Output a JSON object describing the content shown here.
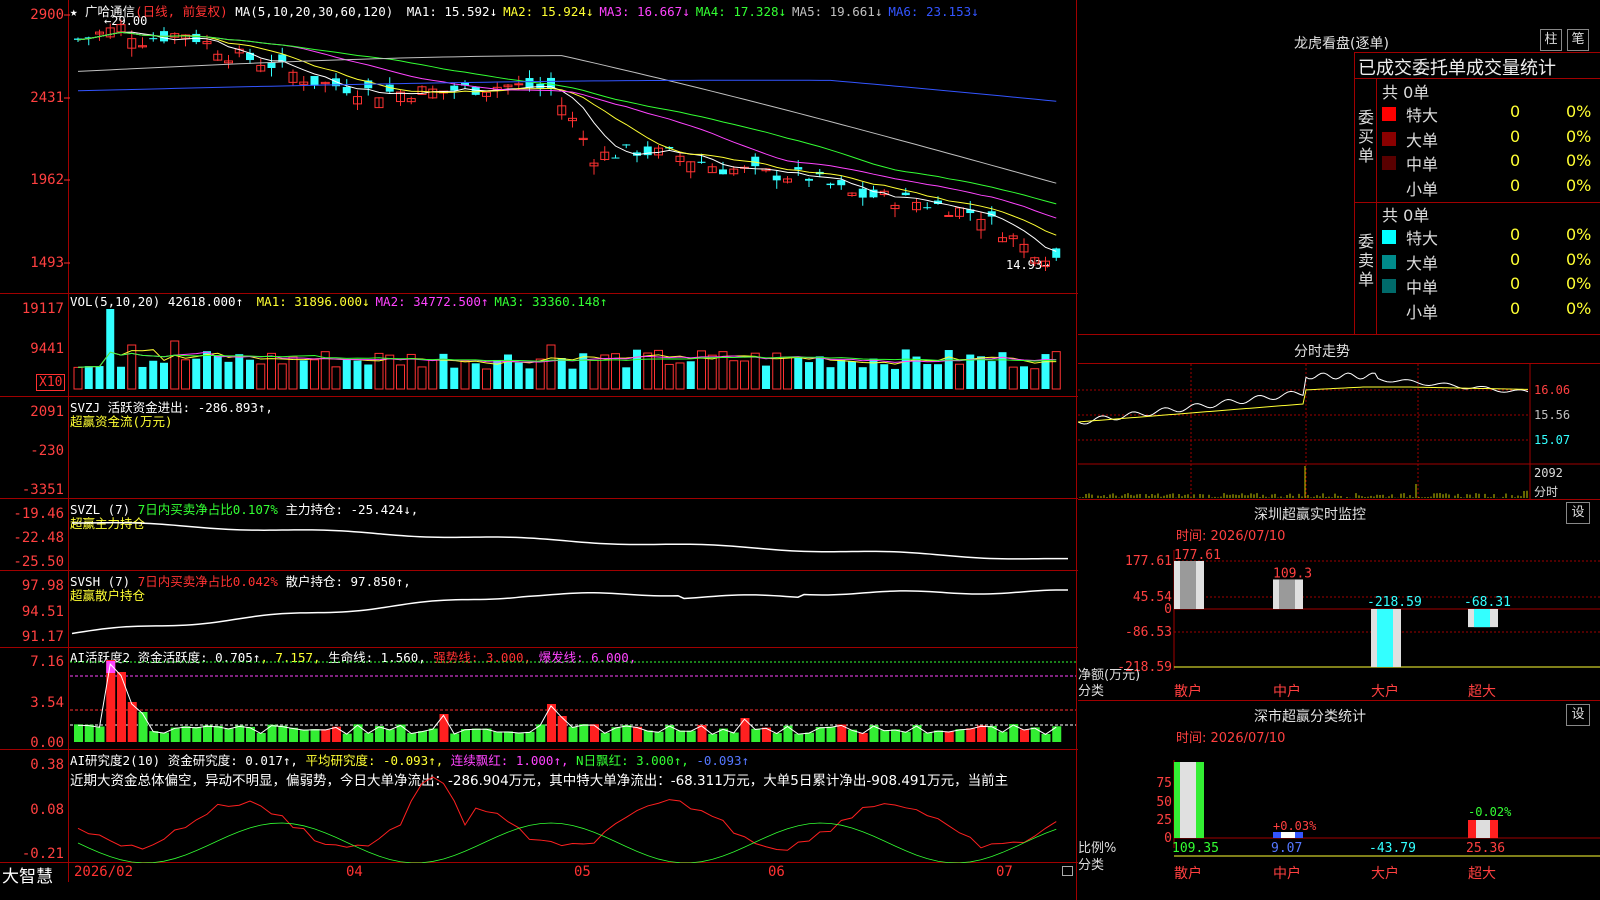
{
  "stock": {
    "title": "★ 广哈通信",
    "period": "(日线, 前复权)",
    "high_label": "29.00",
    "low_label": "14.93"
  },
  "main": {
    "ma_label": "MA(5,10,20,30,60,120)",
    "ma": [
      {
        "label": "MA1: 15.592↓",
        "color": "#ffffff"
      },
      {
        "label": "MA2: 15.924↓",
        "color": "#ffff33"
      },
      {
        "label": "MA3: 16.667↓",
        "color": "#ff44ff"
      },
      {
        "label": "MA4: 17.328↓",
        "color": "#33ff33"
      },
      {
        "label": "MA5: 19.661↓",
        "color": "#c0c0c0"
      },
      {
        "label": "MA6: 23.153↓",
        "color": "#3355ff"
      }
    ],
    "y_labels": [
      "2900",
      "2431",
      "1962",
      "1493"
    ]
  },
  "vol": {
    "label": "VOL(5,10,20)",
    "value": "42618.000↑",
    "ma": [
      {
        "label": "MA1: 31896.000↓",
        "color": "#ffff33"
      },
      {
        "label": "MA2: 34772.500↑",
        "color": "#ff44ff"
      },
      {
        "label": "MA3: 33360.148↑",
        "color": "#33ff33"
      }
    ],
    "y_labels": [
      "19117",
      "9441"
    ],
    "unit": "X10"
  },
  "svzj": {
    "label": "SVZJ",
    "text": "活跃资金进出: -286.893↑,",
    "sub": "超赢资金流(万元)",
    "y_labels": [
      "2091",
      "-230",
      "-3351"
    ]
  },
  "svzl": {
    "label": "SVZL (7)",
    "ratio": "7日内买卖净占比0.107%",
    "text": "主力持仓: -25.424↓,",
    "sub": "超赢主力持仓",
    "y_labels": [
      "-19.46",
      "-22.48",
      "-25.50"
    ]
  },
  "svsh": {
    "label": "SVSH (7)",
    "ratio": "7日内买卖净占比0.042%",
    "text": "散户持仓: 97.850↑,",
    "sub": "超赢散户持仓",
    "y_labels": [
      "97.98",
      "94.51",
      "91.17"
    ]
  },
  "ai1": {
    "label": "AI活跃度2",
    "t1": "资金活跃度: 0.705↑",
    "t2": ", 7.157,",
    "t3": "生命线: 1.560,",
    "t4": "强势线: 3.000,",
    "t5": "爆发线: 6.000,",
    "y_labels": [
      "7.16",
      "3.54",
      "0.00"
    ]
  },
  "ai2": {
    "label": "AI研究度2(10)",
    "t1": "资金研究度: 0.017↑,",
    "t2": "平均研究度: -0.093↑,",
    "t3": "连续飘红: 1.000↑,",
    "t4": "N日飘红: 3.000↑,",
    "t5": "-0.093↑",
    "comment": "近期大资金总体偏空，异动不明显，偏弱势，今日大单净流出：-286.904万元，其中特大单净流出：-68.311万元，大单5日累计净出-908.491万元，当前主",
    "y_labels": [
      "0.38",
      "0.08",
      "-0.21"
    ]
  },
  "xaxis": {
    "brand": "大智慧",
    "labels": [
      "2026/02",
      "04",
      "05",
      "06",
      "07"
    ]
  },
  "lhb": {
    "title": "龙虎看盘(逐单)",
    "btn1": "柱",
    "btn2": "笔",
    "heading": "已成交委托单成交量统计",
    "buy_label": "委买单",
    "sell_label": "委卖单",
    "buy_total": "共 0单",
    "sell_total": "共 0单",
    "buy_rows": [
      {
        "name": "特大",
        "val": "0",
        "pct": "0%",
        "color": "#ff0000"
      },
      {
        "name": "大单",
        "val": "0",
        "pct": "0%",
        "color": "#8b0000"
      },
      {
        "name": "中单",
        "val": "0",
        "pct": "0%",
        "color": "#5a0000"
      },
      {
        "name": "小单",
        "val": "0",
        "pct": "0%",
        "color": "#000000"
      }
    ],
    "sell_rows": [
      {
        "name": "特大",
        "val": "0",
        "pct": "0%",
        "color": "#00ffff"
      },
      {
        "name": "大单",
        "val": "0",
        "pct": "0%",
        "color": "#008b8b"
      },
      {
        "name": "中单",
        "val": "0",
        "pct": "0%",
        "color": "#006a6a"
      },
      {
        "name": "小单",
        "val": "0",
        "pct": "0%",
        "color": "#000000"
      }
    ]
  },
  "intraday": {
    "title": "分时走势",
    "prices": [
      "16.06",
      "15.56",
      "15.07"
    ],
    "vol_label": "2092",
    "vol_unit": "分时"
  },
  "monitor": {
    "title": "深圳超赢实时监控",
    "btn": "设",
    "time": "时间: 2026/07/10",
    "y_labels": [
      "177.61",
      "45.54",
      "0",
      "-86.53",
      "-218.59"
    ],
    "axis_unit": "净额(万元)",
    "axis_cat": "分类",
    "chart_data": {
      "type": "bar",
      "categories": [
        "散户",
        "中户",
        "大户",
        "超大"
      ],
      "values": [
        177.61,
        109.3,
        -218.59,
        -68.31
      ],
      "value_labels": [
        "177.61",
        "109.3",
        "-218.59",
        "-68.31"
      ],
      "ylabel": "净额(万元)",
      "xlabel": "分类"
    }
  },
  "classify": {
    "title": "深市超赢分类统计",
    "btn": "设",
    "time": "时间: 2026/07/10",
    "y_labels": [
      "75",
      "50",
      "25",
      "0"
    ],
    "axis_unit": "比例%",
    "axis_cat": "分类",
    "chart_data": {
      "type": "bar",
      "categories": [
        "散户",
        "中户",
        "大户",
        "超大"
      ],
      "values": [
        109.35,
        9.07,
        -43.79,
        25.36
      ],
      "value_labels": [
        "109.35",
        "9.07",
        "-43.79",
        "25.36"
      ],
      "bar_labels": [
        "",
        "+0.03%",
        "",
        "-0.02%"
      ],
      "ylabel": "比例%",
      "xlabel": "分类"
    }
  }
}
